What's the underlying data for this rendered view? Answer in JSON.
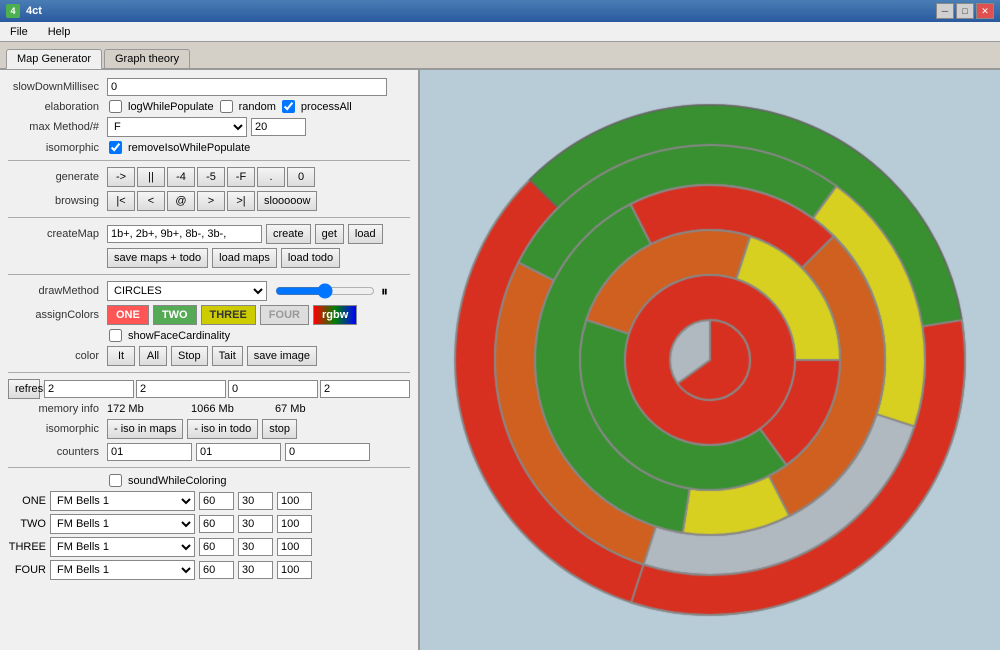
{
  "window": {
    "title": "4ct",
    "icon": "4"
  },
  "menu": {
    "items": [
      "File",
      "Help"
    ]
  },
  "tabs": [
    {
      "id": "map-generator",
      "label": "Map Generator",
      "active": true
    },
    {
      "id": "graph-theory",
      "label": "Graph theory",
      "active": false
    }
  ],
  "form": {
    "slowdown_label": "slowDownMillisec",
    "slowdown_value": "0",
    "elaboration_label": "elaboration",
    "log_label": "logWhilePopulate",
    "random_label": "random",
    "process_all_label": "processAll",
    "max_method_label": "max Method/#",
    "max_method_value": "F",
    "max_method_num": "20",
    "isomorphic_label": "isomorphic",
    "remove_iso_label": "removeIsoWhilePopulate",
    "generate_label": "generate",
    "browsing_label": "browsing",
    "btn_arrow_right": "->",
    "btn_pause": "||",
    "btn_minus4": "-4",
    "btn_minus5": "-5",
    "btn_minusF": "-F",
    "btn_dot": ".",
    "btn_zero": "0",
    "btn_bar_left": "|<",
    "btn_left": "<",
    "btn_at": "@",
    "btn_right": ">",
    "btn_bar_right": ">|",
    "btn_slow": "slooooow",
    "createMap_label": "createMap",
    "createMap_value": "1b+, 2b+, 9b+, 8b-, 3b-,",
    "btn_create": "create",
    "btn_get": "get",
    "btn_load": "load",
    "btn_save_maps": "save maps + todo",
    "btn_load_maps": "load maps",
    "btn_load_todo": "load todo",
    "drawMethod_label": "drawMethod",
    "drawMethod_value": "CIRCLES",
    "assignColors_label": "assignColors",
    "btn_one": "ONE",
    "btn_two": "TWO",
    "btn_three": "THREE",
    "btn_four": "FOUR",
    "btn_rgbw": "rgbw",
    "showFaceCardinality_label": "showFaceCardinality",
    "color_label": "color",
    "btn_it": "It",
    "btn_all": "All",
    "btn_stop": "Stop",
    "btn_tait": "Tait",
    "btn_save_image": "save image",
    "btn_refresh_info": "refreshInfo",
    "counter_values": [
      "2",
      "2",
      "0",
      "2"
    ],
    "memory_label": "memory info",
    "mem1": "172 Mb",
    "mem2": "1066 Mb",
    "mem3": "67 Mb",
    "isomorphic2_label": "isomorphic",
    "btn_iso_maps": "- iso in maps",
    "btn_iso_todo": "- iso in todo",
    "btn_stop2": "stop",
    "counters_label": "counters",
    "counter2_values": [
      "01",
      "01",
      "0"
    ],
    "sound_label": "soundWhileColoring",
    "instruments": [
      {
        "label": "ONE",
        "value": "FM Bells 1",
        "v1": "60",
        "v2": "30",
        "v3": "100"
      },
      {
        "label": "TWO",
        "value": "FM Bells 1",
        "v1": "60",
        "v2": "30",
        "v3": "100"
      },
      {
        "label": "THREE",
        "value": "FM Bells 1",
        "v1": "60",
        "v2": "30",
        "v3": "100"
      },
      {
        "label": "FOUR",
        "value": "FM Bells 1",
        "v1": "60",
        "v2": "30",
        "v3": "100"
      }
    ]
  },
  "colors": {
    "red": "#e03020",
    "green": "#3a9030",
    "yellow": "#d4d020",
    "orange": "#e06020",
    "gray": "#b0b8c0",
    "bg": "#b8ccd8"
  }
}
